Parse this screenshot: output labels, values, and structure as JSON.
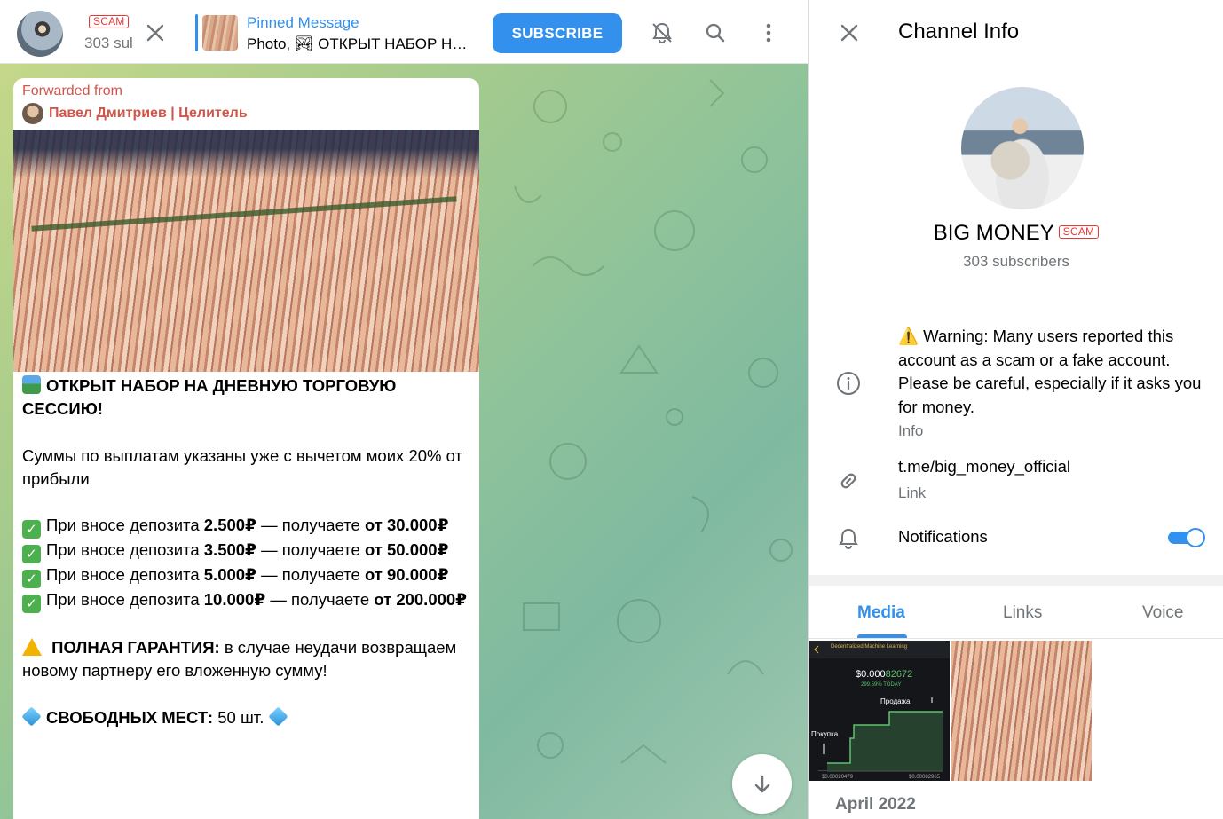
{
  "chat_header": {
    "scam_badge": "SCAM",
    "subscribers_truncated": "303 sul",
    "pinned_title": "Pinned Message",
    "pinned_text": "Photo, 🏞 ОТКРЫТ НАБОР НА ДНЕВНУЮ ТОРГОВУЮ СЕССИЮ!",
    "subscribe_label": "SUBSCRIBE",
    "icons": [
      "close-icon",
      "mute-bell-icon",
      "search-icon",
      "more-vertical-icon"
    ]
  },
  "message": {
    "forwarded_label": "Forwarded from",
    "forwarded_name": "Павел Дмитриев | Целитель",
    "headline": "ОТКРЫТ НАБОР НА ДНЕВНУЮ ТОРГОВУЮ СЕССИЮ!",
    "intro": "Суммы по выплатам указаны уже с вычетом моих 20% от прибыли",
    "offers": [
      {
        "prefix": "При вносе депозита ",
        "deposit": "2.500₽",
        "middle": " —  получаете ",
        "from": "от",
        "payout": "30.000₽"
      },
      {
        "prefix": "При вносе депозита ",
        "deposit": "3.500₽",
        "middle": "  —  получаете ",
        "from": "от",
        "payout": "50.000₽"
      },
      {
        "prefix": "При вносе депозита ",
        "deposit": "5.000₽",
        "middle": "  —  получаете ",
        "from": "от",
        "payout": "90.000₽"
      },
      {
        "prefix": "При вносе депозита ",
        "deposit": "10.000₽",
        "middle": "  —  получаете ",
        "from": "от",
        "payout": "200.000₽"
      }
    ],
    "guarantee_title": "ПОЛНАЯ ГАРАНТИЯ:",
    "guarantee_text": " в случае неудачи возвращаем новому партнеру его вложенную сумму!",
    "seats_title": "СВОБОДНЫХ МЕСТ:",
    "seats_value": " 50 шт. "
  },
  "channel_info": {
    "title": "Channel Info",
    "name": "BIG MONEY",
    "scam_badge": "SCAM",
    "subscribers": "303 subscribers",
    "warning": "⚠️ Warning: Many users reported this account as a scam or a fake account. Please be careful, especially if it asks you for money.",
    "warning_label": "Info",
    "link": "t.me/big_money_official",
    "link_label": "Link",
    "notifications_label": "Notifications",
    "notifications_on": true,
    "tabs": [
      "Media",
      "Links",
      "Voice"
    ],
    "active_tab": "Media",
    "media_thumb_1": {
      "header": "Decentralized Machine Learning",
      "price_main": "$0.000",
      "price_tail": "82672",
      "change": "299.59% TODAY",
      "sell_label": "Продажа",
      "buy_label": "Покупка",
      "footer_left": "$0.00020479",
      "footer_right": "$0.00082965"
    },
    "date_label": "April 2022"
  },
  "colors": {
    "accent": "#3390ec",
    "scam_red": "#e53935",
    "forward_name": "#d1564a",
    "muted_text": "#707579"
  }
}
